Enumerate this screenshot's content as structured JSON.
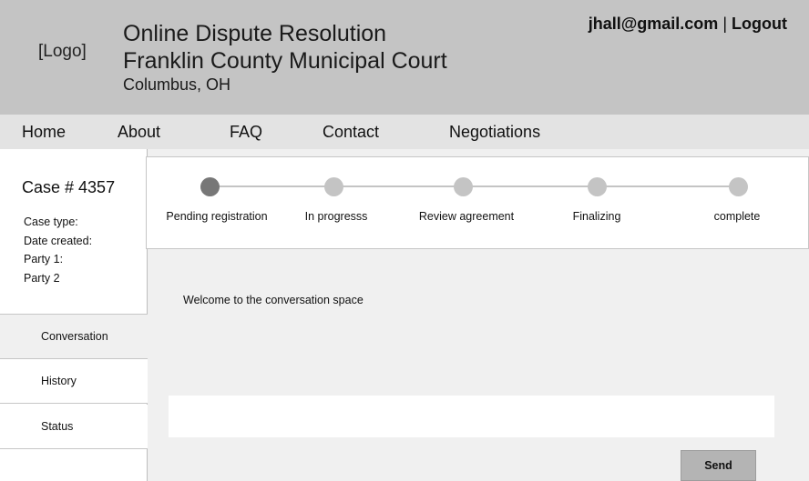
{
  "header": {
    "logo": "[Logo]",
    "title": "Online Dispute Resolution",
    "court": "Franklin County Municipal Court",
    "location": "Columbus, OH",
    "user_email": "jhall@gmail.com",
    "separator": "|",
    "logout": "Logout"
  },
  "nav": {
    "home": "Home",
    "about": "About",
    "faq": "FAQ",
    "contact": "Contact",
    "negotiations": "Negotiations"
  },
  "case": {
    "number": "Case # 4357",
    "type_label": "Case type:",
    "date_label": "Date created:",
    "party1_label": "Party 1:",
    "party2_label": "Party 2"
  },
  "sidebar_tabs": {
    "conversation": "Conversation",
    "history": "History",
    "status": "Status"
  },
  "progress": {
    "steps": [
      "Pending registration",
      "In progresss",
      "Review agreement",
      "Finalizing",
      "complete"
    ],
    "current_step": "Pending registration"
  },
  "conversation": {
    "welcome": "Welcome to the conversation space",
    "input_value": "",
    "send_label": "Send"
  }
}
